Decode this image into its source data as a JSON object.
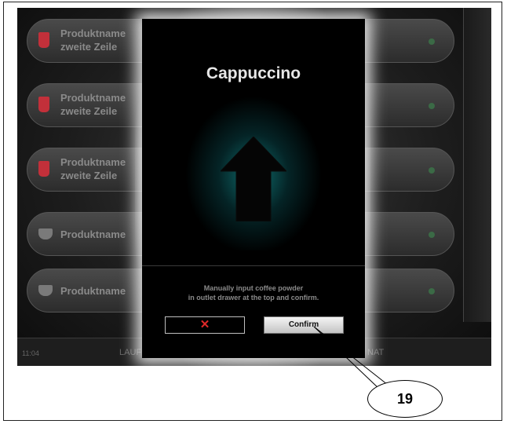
{
  "background_rows": [
    {
      "line1": "Produktname",
      "line2": "zweite Zeile",
      "icon": "red-cup-icon"
    },
    {
      "line1": "Produktname",
      "line2": "zweite Zeile",
      "icon": "red-cup-icon"
    },
    {
      "line1": "Produktname",
      "line2": "zweite Zeile",
      "icon": "red-cup-icon"
    },
    {
      "line1": "Produktname",
      "line2": "",
      "icon": "coffee-cup-icon"
    },
    {
      "line1": "Produktname",
      "line2": "",
      "icon": "coffee-cup-icon"
    }
  ],
  "bottom_bar": {
    "time": "11:04",
    "left_label": "LAUFEN",
    "right_label": "NAT"
  },
  "dialog": {
    "title": "Cappuccino",
    "message_line1": "Manually input coffee powder",
    "message_line2": "in outlet drawer at the top and confirm.",
    "cancel_symbol": "✕",
    "confirm_label": "Confirm"
  },
  "callout": {
    "number": "19"
  },
  "colors": {
    "dialog_bg": "#000000",
    "arrow_glow": "#148c8c",
    "cancel_x": "#e02828"
  }
}
